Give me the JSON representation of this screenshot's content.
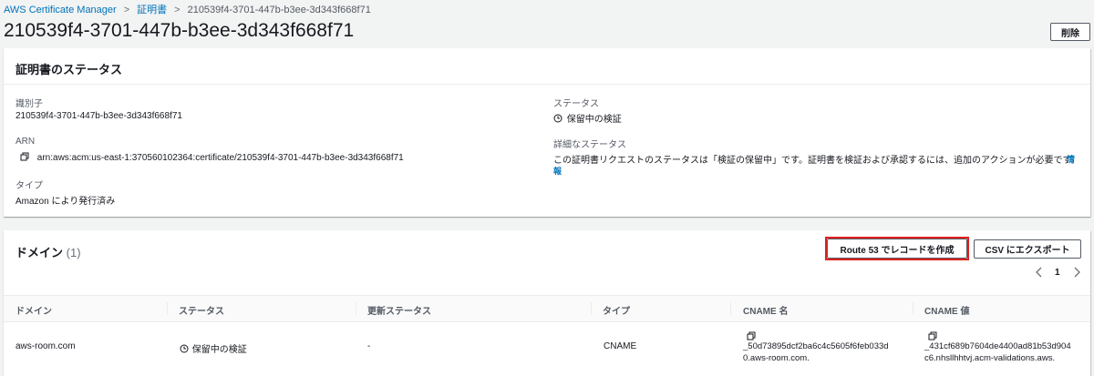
{
  "breadcrumb": {
    "items": [
      "AWS Certificate Manager",
      "証明書",
      "210539f4-3701-447b-b3ee-3d343f668f71"
    ]
  },
  "page": {
    "title": "210539f4-3701-447b-b3ee-3d343f668f71",
    "delete_label": "削除"
  },
  "status_panel": {
    "heading": "証明書のステータス",
    "identifier_label": "識別子",
    "identifier_value": "210539f4-3701-447b-b3ee-3d343f668f71",
    "arn_label": "ARN",
    "arn_value": "arn:aws:acm:us-east-1:370560102364:certificate/210539f4-3701-447b-b3ee-3d343f668f71",
    "type_label": "タイプ",
    "type_value": "Amazon により発行済み",
    "status_label": "ステータス",
    "status_value": "保留中の検証",
    "detail_label": "詳細なステータス",
    "detail_value": "この証明書リクエストのステータスは「検証の保留中」です。証明書を検証および承認するには、追加のアクションが必要です。",
    "info_link_line1": "情",
    "info_link_line2": "報"
  },
  "domain_panel": {
    "heading": "ドメイン",
    "count": "(1)",
    "route53_label": "Route 53 でレコードを作成",
    "csv_label": "CSV にエクスポート",
    "page_number": "1",
    "columns": [
      "ドメイン",
      "ステータス",
      "更新ステータス",
      "タイプ",
      "CNAME 名",
      "CNAME 値"
    ],
    "rows": [
      {
        "domain": "aws-room.com",
        "status": "保留中の検証",
        "renewal": "-",
        "type": "CNAME",
        "cname_name_1": "_50d73895dcf2ba6c4c5605f6feb033d",
        "cname_name_2": "0.aws-room.com.",
        "cname_value_1": "_431cf689b7604de4400ad81b53d904",
        "cname_value_2": "c6.nhsllhhtvj.acm-validations.aws."
      }
    ]
  },
  "colors": {
    "link": "#0073bb",
    "highlight": "#e0201f",
    "background": "#f2f3f3"
  }
}
